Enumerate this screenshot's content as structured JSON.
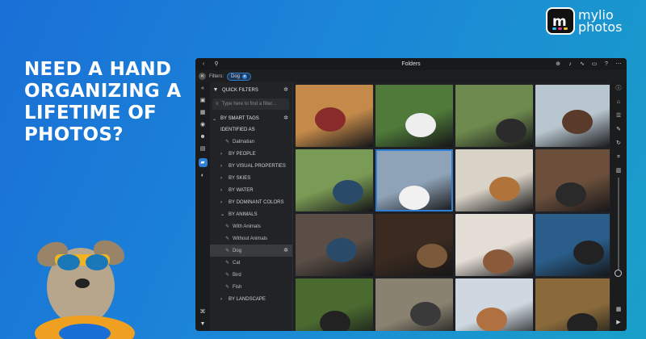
{
  "brand": {
    "logo_mark": "m",
    "logo_line1": "mylio",
    "logo_line2": "photos",
    "dot_colors": [
      "#2ec4f1",
      "#e63c8f",
      "#f4c430"
    ]
  },
  "headline": "NEED A HAND ORGANIZING A LIFETIME OF PHOTOS?",
  "app": {
    "title": "Folders",
    "filter_label": "Filters:",
    "filter_chip": "Dog",
    "sidebar": {
      "quick_filters": "QUICK FILTERS",
      "find_placeholder": "Type here to find a filter...",
      "smart_tags": "BY SMART TAGS",
      "identified_as": "IDENTIFIED AS",
      "identified_item": "Dalmatian",
      "categories": [
        "BY PEOPLE",
        "BY VISUAL PROPERTIES",
        "BY SKIES",
        "BY WATER",
        "BY DOMINANT COLORS"
      ],
      "animals": "BY ANIMALS",
      "animal_items": [
        "With Animals",
        "Without Animals",
        "Dog",
        "Cat",
        "Bird",
        "Fish"
      ],
      "selected_item": "Dog",
      "landscape": "BY LANDSCAPE"
    },
    "photos": [
      {
        "name": "golden-retriever-flag",
        "bg": "#c48a4a",
        "sub": "#8a2b2b"
      },
      {
        "name": "white-puppy-running",
        "bg": "#4f7a3a",
        "sub": "#eeeeee"
      },
      {
        "name": "man-with-dog-field",
        "bg": "#6e8a4e",
        "sub": "#2b2b2b"
      },
      {
        "name": "women-with-dog-beach",
        "bg": "#b8c6cf",
        "sub": "#5a3a2a"
      },
      {
        "name": "man-training-dog",
        "bg": "#7a9b55",
        "sub": "#2a4a6a"
      },
      {
        "name": "dalmatian-selected",
        "bg": "#8fa3b8",
        "sub": "#f1f1f1"
      },
      {
        "name": "woman-laptop-dog",
        "bg": "#d9d2c6",
        "sub": "#b0743a"
      },
      {
        "name": "couple-with-dog",
        "bg": "#6b4f3b",
        "sub": "#2a2a2a"
      },
      {
        "name": "man-dog-sofa",
        "bg": "#5a4e46",
        "sub": "#2a4a6a"
      },
      {
        "name": "woman-shepherd-closeup",
        "bg": "#3a2a20",
        "sub": "#7a5a3a"
      },
      {
        "name": "woman-small-dog",
        "bg": "#e4ddd5",
        "sub": "#8a5a3a"
      },
      {
        "name": "dogs-swimming",
        "bg": "#2a5d8a",
        "sub": "#222222"
      },
      {
        "name": "two-dogs-grass",
        "bg": "#4a6a30",
        "sub": "#222222"
      },
      {
        "name": "dogs-road-people",
        "bg": "#8a8270",
        "sub": "#3a3a3a"
      },
      {
        "name": "dogs-boat",
        "bg": "#cfd8e0",
        "sub": "#b07040"
      },
      {
        "name": "dogs-autumn",
        "bg": "#8a6a3a",
        "sub": "#222222"
      }
    ],
    "selected_photo": 5
  }
}
